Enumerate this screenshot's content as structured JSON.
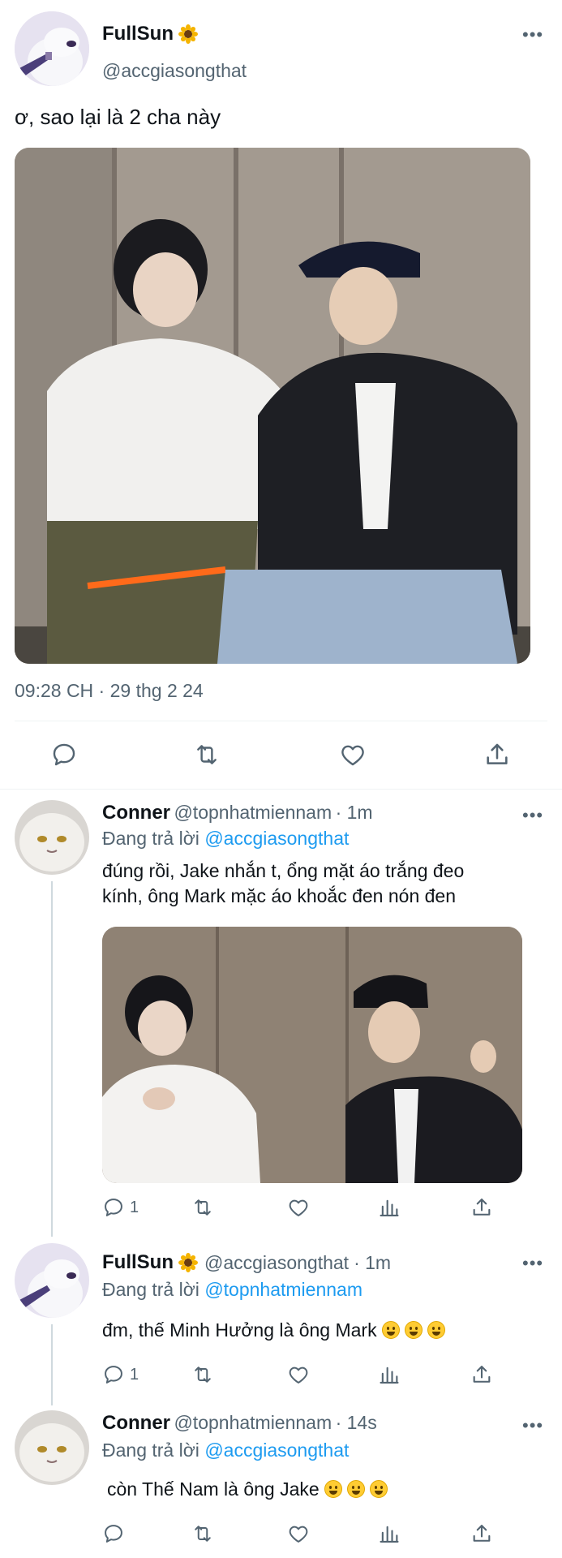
{
  "main_tweet": {
    "display_name": "FullSun",
    "name_emoji": "sunflower",
    "handle": "@accgiasongthat",
    "text": "ơ, sao lại là 2 cha này",
    "timestamp": "09:28 CH · 29 thg 2 24"
  },
  "replies": [
    {
      "display_name": "Conner",
      "handle": "@topnhatmiennam",
      "time": "· 1m",
      "replying_prefix": "Đang trả lời",
      "replying_to": "@accgiasongthat",
      "text_line1": "đúng rồi, Jake nhắn t, ổng mặt áo trắng đeo",
      "text_line2": "kính, ông Mark mặc áo khoắc đen nón đen",
      "reply_count": "1"
    },
    {
      "display_name": "FullSun",
      "name_emoji": "sunflower",
      "handle": "@accgiasongthat",
      "time": "· 1m",
      "replying_prefix": "Đang trả lời",
      "replying_to": "@topnhatmiennam",
      "text": "đm, thế Minh Hưởng là ông Mark",
      "reply_count": "1"
    },
    {
      "display_name": "Conner",
      "handle": "@topnhatmiennam",
      "time": "· 14s",
      "replying_prefix": "Đang trả lời",
      "replying_to": "@accgiasongthat",
      "text": "còn Thế Nam là ông Jake"
    }
  ],
  "icons": {
    "more": "more-dots-icon",
    "reply": "reply-bubble-icon",
    "retweet": "retweet-icon",
    "like": "heart-icon",
    "views": "bar-chart-icon",
    "share": "share-upload-icon"
  },
  "colors": {
    "link": "#1d9bf0",
    "secondary_text": "#536471",
    "divider": "#eff3f4"
  }
}
